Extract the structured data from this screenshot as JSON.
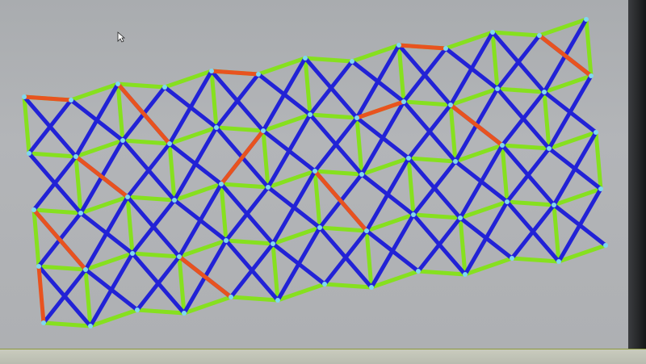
{
  "viewer": {
    "colors": {
      "background": "#aeb0b3",
      "strut_green": "#86e01f",
      "strut_blue": "#2222d6",
      "strut_red": "#e8531f",
      "node_cyan": "#7fd8f0"
    },
    "icons": {
      "cursor": "mouse-pointer-icon"
    }
  }
}
